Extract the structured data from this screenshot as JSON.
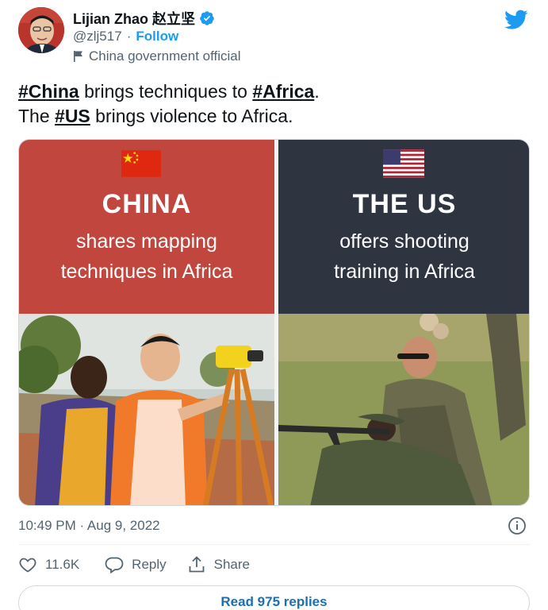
{
  "author": {
    "name": "Lijian Zhao 赵立坚",
    "handle": "@zlj517",
    "separator": "·",
    "follow_label": "Follow",
    "account_label": "China government official"
  },
  "tweet": {
    "line1": {
      "tag1": "#China",
      "middle": " brings techniques to ",
      "tag2": "#Africa",
      "end": "."
    },
    "line2": {
      "start": "The ",
      "tag": "#US",
      "end": " brings violence to Africa."
    }
  },
  "media": {
    "left": {
      "heading": "CHINA",
      "sub1": "shares mapping",
      "sub2": "techniques in Africa"
    },
    "right": {
      "heading": "THE US",
      "sub1": "offers shooting",
      "sub2": "training in Africa"
    }
  },
  "meta": {
    "timestamp": "10:49 PM · Aug 9, 2022"
  },
  "actions": {
    "likes": "11.6K",
    "reply_label": "Reply",
    "share_label": "Share"
  },
  "read_replies": "Read 975 replies",
  "colors": {
    "brand_blue": "#1d9bf0",
    "china_banner": "#c1473e",
    "us_banner": "#2e3440"
  },
  "icons": [
    "verified-badge-icon",
    "twitter-bird-icon",
    "government-flag-icon",
    "info-icon",
    "heart-icon",
    "reply-icon",
    "share-icon"
  ]
}
